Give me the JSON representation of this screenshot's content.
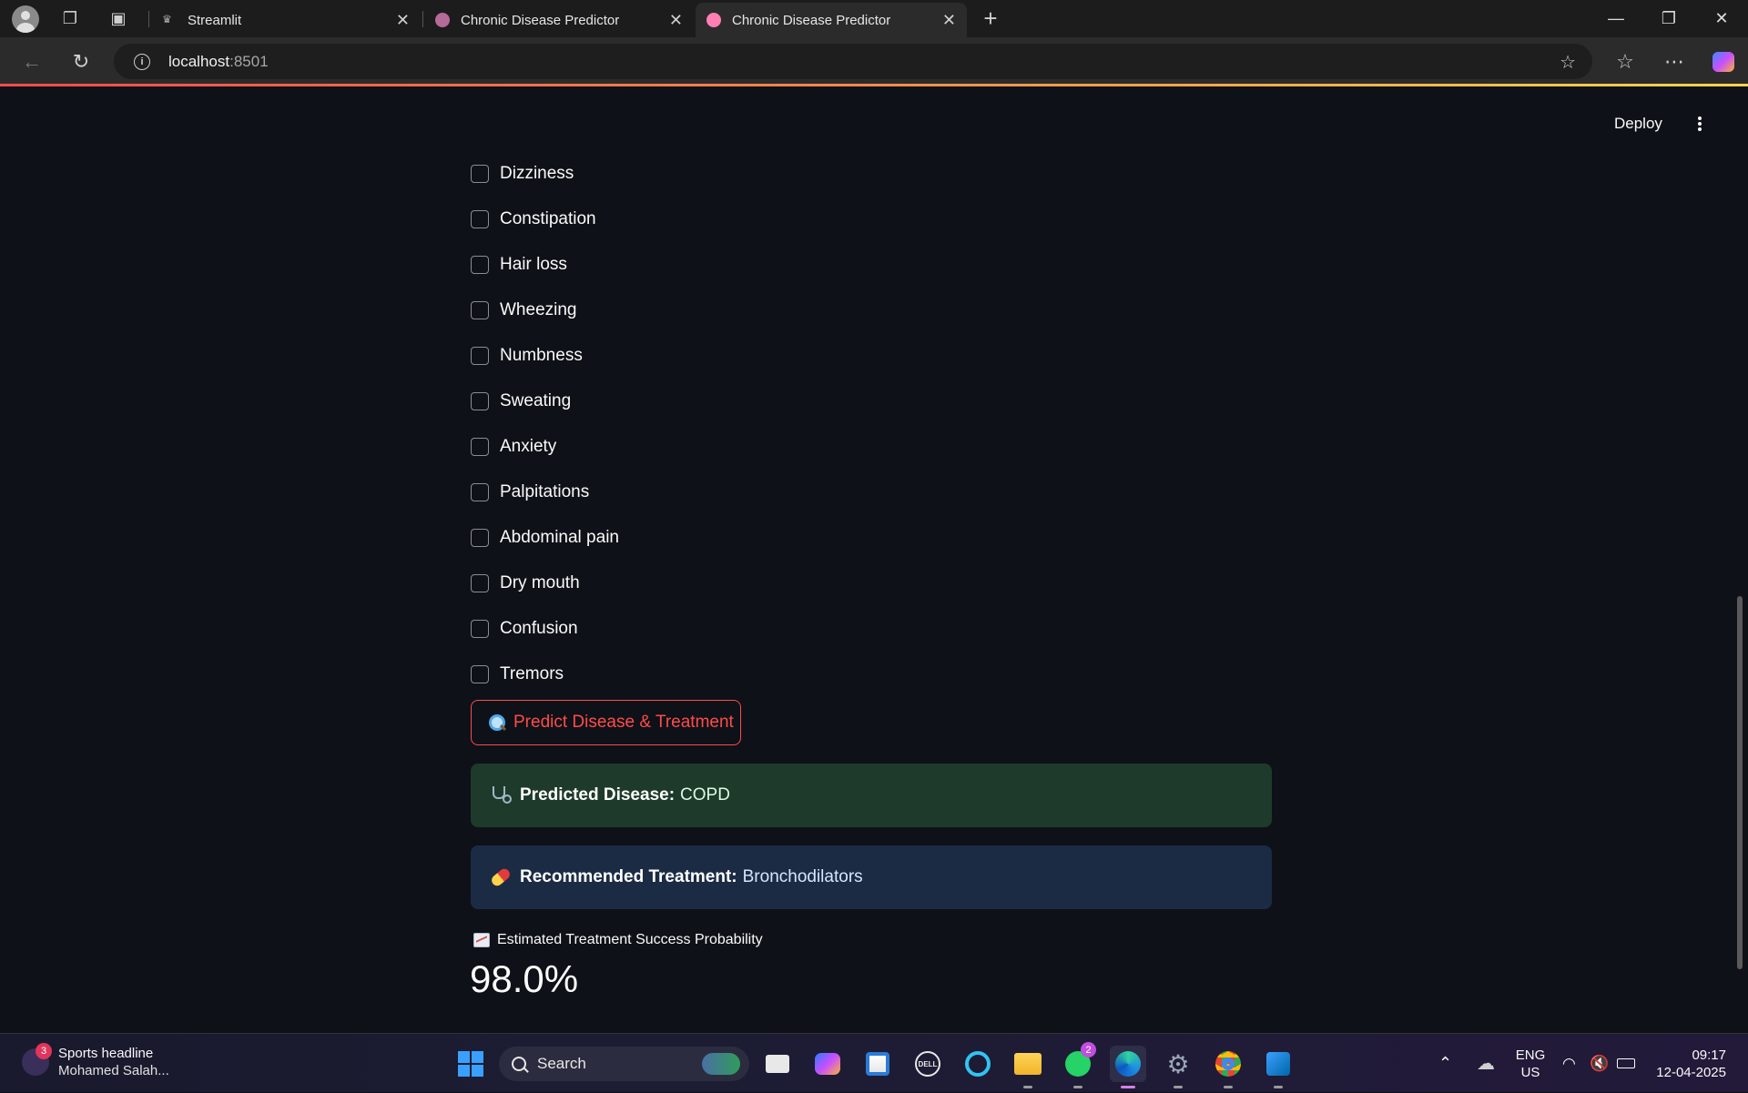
{
  "browser": {
    "tabs": [
      {
        "label": "Streamlit",
        "active": false
      },
      {
        "label": "Chronic Disease Predictor",
        "active": false
      },
      {
        "label": "Chronic Disease Predictor",
        "active": true
      }
    ],
    "url_host": "localhost",
    "url_port": ":8501"
  },
  "app": {
    "deploy_label": "Deploy",
    "symptoms": [
      {
        "label": "Dizziness",
        "checked": false
      },
      {
        "label": "Constipation",
        "checked": false
      },
      {
        "label": "Hair loss",
        "checked": false
      },
      {
        "label": "Wheezing",
        "checked": false
      },
      {
        "label": "Numbness",
        "checked": false
      },
      {
        "label": "Sweating",
        "checked": false
      },
      {
        "label": "Anxiety",
        "checked": false
      },
      {
        "label": "Palpitations",
        "checked": false
      },
      {
        "label": "Abdominal pain",
        "checked": false
      },
      {
        "label": "Dry mouth",
        "checked": false
      },
      {
        "label": "Confusion",
        "checked": false
      },
      {
        "label": "Tremors",
        "checked": false
      }
    ],
    "predict_button": "Predict Disease & Treatment",
    "prediction": {
      "label": "Predicted Disease:",
      "value": "COPD"
    },
    "treatment": {
      "label": "Recommended Treatment:",
      "value": "Bronchodilators"
    },
    "metric": {
      "label": "Estimated Treatment Success Probability",
      "value": "98.0%"
    },
    "colors": {
      "accent": "#ff4b4b",
      "background": "#0e1117",
      "success_bg": "#1e3a2a",
      "info_bg": "#1c2b44"
    }
  },
  "taskbar": {
    "news_badge": "3",
    "news_title": "Sports headline",
    "news_sub": "Mohamed Salah...",
    "search_label": "Search",
    "whatsapp_badge": "2",
    "lang_line1": "ENG",
    "lang_line2": "US",
    "time": "09:17",
    "date": "12-04-2025"
  }
}
